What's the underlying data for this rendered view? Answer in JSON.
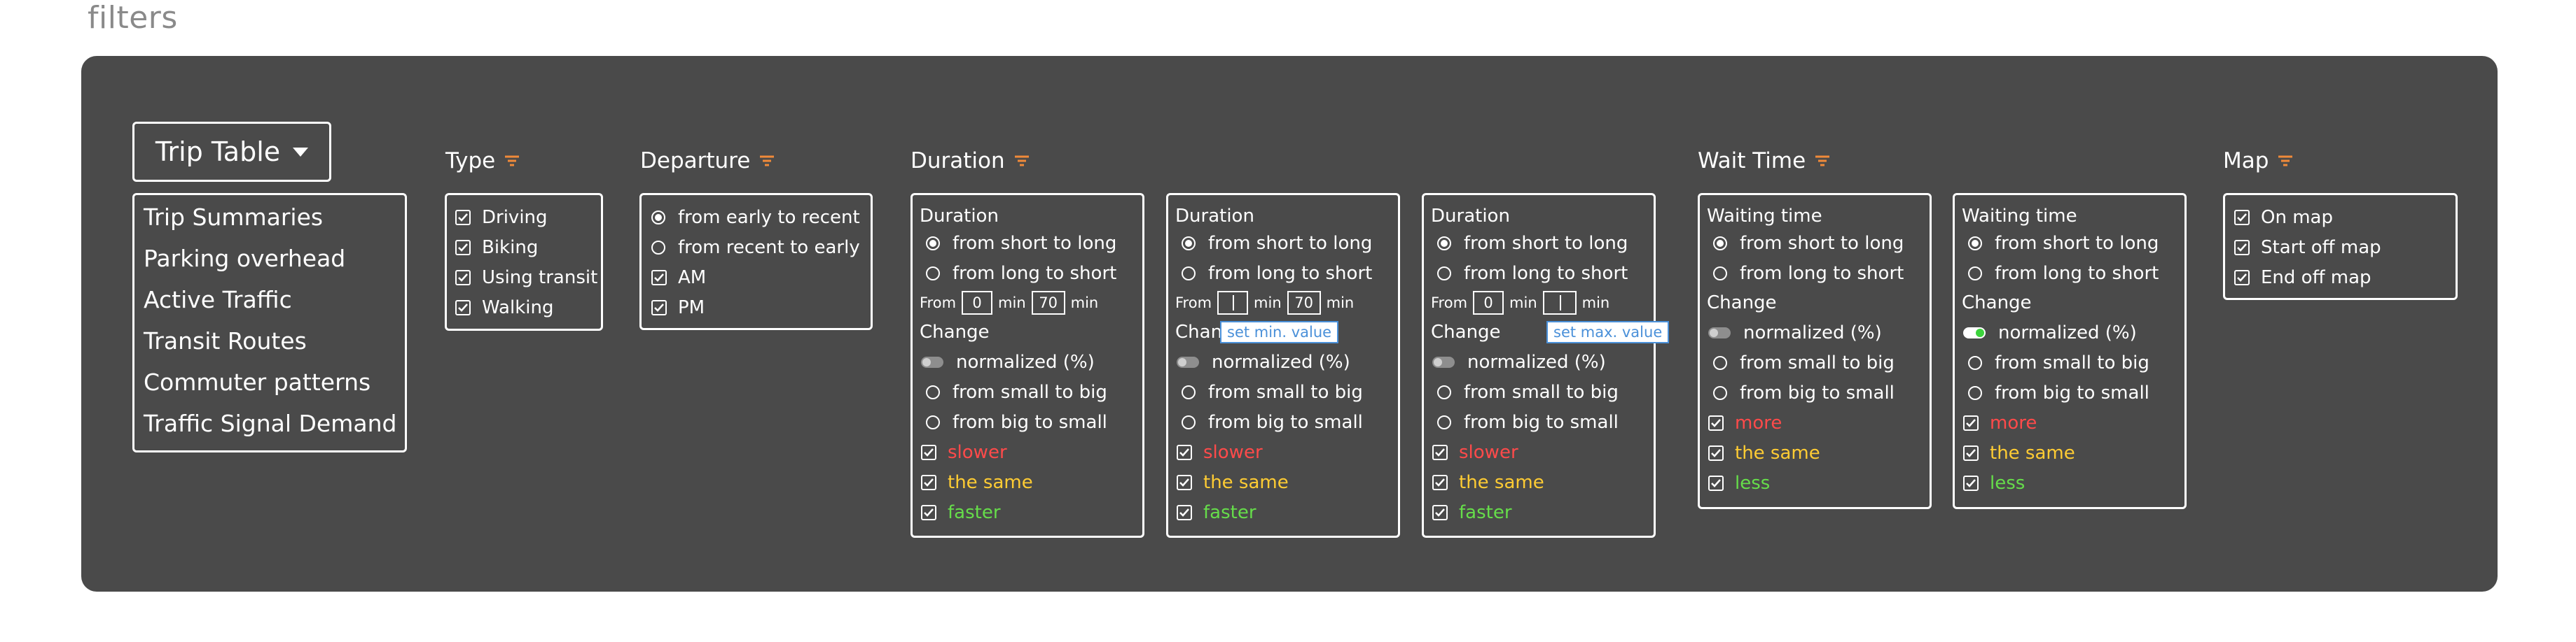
{
  "page": {
    "title": "filters"
  },
  "trip_table": {
    "label": "Trip Table",
    "items": [
      "Trip Summaries",
      "Parking overhead",
      "Active Traffic",
      "Transit Routes",
      "Commuter patterns",
      "Traffic Signal Demand"
    ]
  },
  "type": {
    "heading": "Type",
    "options": [
      {
        "label": "Driving",
        "checked": true
      },
      {
        "label": "Biking",
        "checked": true
      },
      {
        "label": "Using transit",
        "checked": true
      },
      {
        "label": "Walking",
        "checked": true
      }
    ]
  },
  "departure": {
    "heading": "Departure",
    "sort_options": [
      {
        "label": "from early to recent",
        "selected": true
      },
      {
        "label": "from recent to early",
        "selected": false
      }
    ],
    "checks": [
      {
        "label": "AM",
        "checked": true
      },
      {
        "label": "PM",
        "checked": true
      }
    ]
  },
  "duration": {
    "heading": "Duration",
    "cards": [
      {
        "title": "Duration",
        "sort": [
          "from short to long",
          "from long to short"
        ],
        "sort_selected": 0,
        "from_label": "From",
        "min_value": "0",
        "min_unit": "min",
        "max_value": "70",
        "max_unit": "min",
        "change_label": "Change",
        "normalized_label": "normalized (%)",
        "normalized_on": false,
        "change_options": [
          "from small to big",
          "from big to small"
        ],
        "results": [
          {
            "label": "slower",
            "color": "red",
            "checked": true
          },
          {
            "label": "the same",
            "color": "yellow",
            "checked": true
          },
          {
            "label": "faster",
            "color": "green",
            "checked": true
          }
        ]
      },
      {
        "title": "Duration",
        "sort": [
          "from short to long",
          "from long to short"
        ],
        "sort_selected": 0,
        "from_label": "From",
        "min_value": "",
        "min_unit": "min",
        "max_value": "70",
        "max_unit": "min",
        "change_label": "Chan",
        "tooltip": "set min. value",
        "normalized_label": "normalized (%)",
        "normalized_on": false,
        "change_options": [
          "from small to big",
          "from big to small"
        ],
        "results": [
          {
            "label": "slower",
            "color": "red",
            "checked": true
          },
          {
            "label": "the same",
            "color": "yellow",
            "checked": true
          },
          {
            "label": "faster",
            "color": "green",
            "checked": true
          }
        ]
      },
      {
        "title": "Duration",
        "sort": [
          "from short to long",
          "from long to short"
        ],
        "sort_selected": 0,
        "from_label": "From",
        "min_value": "0",
        "min_unit": "min",
        "max_value": "",
        "max_unit": "min",
        "change_label": "Change",
        "tooltip": "set max. value",
        "normalized_label": "normalized (%)",
        "normalized_on": false,
        "change_options": [
          "from small to big",
          "from big to small"
        ],
        "results": [
          {
            "label": "slower",
            "color": "red",
            "checked": true
          },
          {
            "label": "the same",
            "color": "yellow",
            "checked": true
          },
          {
            "label": "faster",
            "color": "green",
            "checked": true
          }
        ]
      }
    ]
  },
  "wait_time": {
    "heading": "Wait Time",
    "cards": [
      {
        "title": "Waiting time",
        "sort": [
          "from short to long",
          "from long to short"
        ],
        "sort_selected": 0,
        "change_label": "Change",
        "normalized_label": "normalized (%)",
        "normalized_on": false,
        "change_options": [
          "from small to big",
          "from big to small"
        ],
        "results": [
          {
            "label": "more",
            "color": "red",
            "checked": true
          },
          {
            "label": "the same",
            "color": "yellow",
            "checked": true
          },
          {
            "label": "less",
            "color": "green",
            "checked": true
          }
        ]
      },
      {
        "title": "Waiting time",
        "sort": [
          "from short to long",
          "from long to short"
        ],
        "sort_selected": 0,
        "change_label": "Change",
        "normalized_label": "normalized (%)",
        "normalized_on": true,
        "change_options": [
          "from small to big",
          "from big to small"
        ],
        "results": [
          {
            "label": "more",
            "color": "red",
            "checked": true
          },
          {
            "label": "the same",
            "color": "yellow",
            "checked": true
          },
          {
            "label": "less",
            "color": "green",
            "checked": true
          }
        ]
      }
    ]
  },
  "map": {
    "heading": "Map",
    "options": [
      {
        "label": "On map",
        "checked": true
      },
      {
        "label": "Start off map",
        "checked": true
      },
      {
        "label": "End off map",
        "checked": true
      }
    ]
  },
  "colors": {
    "panel": "#4a4a4a",
    "filter_icon": "#f08a3a",
    "red": "#ff4a4a",
    "yellow": "#ffcc33",
    "green": "#66dd4a",
    "tooltip": "#4a90d9",
    "toggle_on": "#3cd33c"
  },
  "icons": {
    "filter": "filter-lines-icon",
    "check": "check-icon",
    "dropdown": "caret-down-icon"
  }
}
